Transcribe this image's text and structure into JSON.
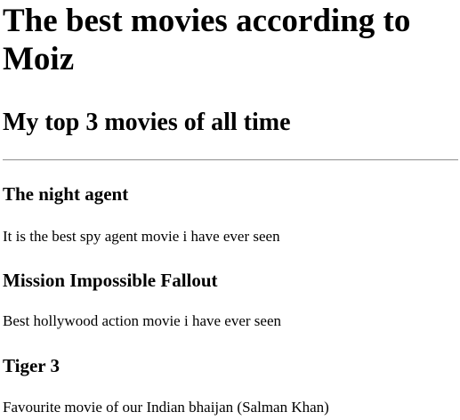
{
  "page": {
    "title": "The best movies according to Moiz",
    "subtitle": "My top 3 movies of all time"
  },
  "movies": [
    {
      "title": "The night agent",
      "description": "It is the best spy agent movie i have ever seen"
    },
    {
      "title": "Mission Impossible Fallout",
      "description": "Best hollywood action movie i have ever seen"
    },
    {
      "title": "Tiger 3",
      "description": "Favourite movie of our Indian bhaijan (Salman Khan)"
    }
  ]
}
